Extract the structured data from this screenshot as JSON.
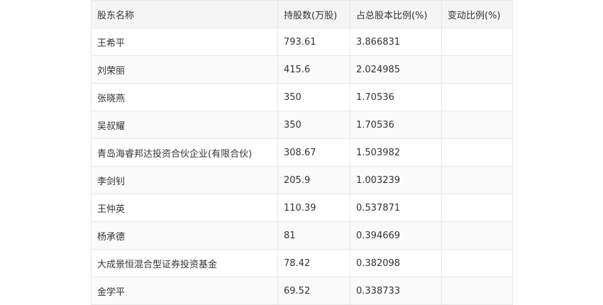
{
  "table": {
    "headers": [
      "股东名称",
      "持股数(万股)",
      "占总股本比例(%)",
      "变动比例(%)"
    ],
    "rows": [
      {
        "name": "王希平",
        "shares": "793.61",
        "ratio": "3.866831",
        "change": ""
      },
      {
        "name": "刘荣丽",
        "shares": "415.6",
        "ratio": "2.024985",
        "change": ""
      },
      {
        "name": "张晓燕",
        "shares": "350",
        "ratio": "1.70536",
        "change": ""
      },
      {
        "name": "吴叔耀",
        "shares": "350",
        "ratio": "1.70536",
        "change": ""
      },
      {
        "name": "青岛海睿邦达投资合伙企业(有限合伙)",
        "shares": "308.67",
        "ratio": "1.503982",
        "change": ""
      },
      {
        "name": "李剑钊",
        "shares": "205.9",
        "ratio": "1.003239",
        "change": ""
      },
      {
        "name": "王仲英",
        "shares": "110.39",
        "ratio": "0.537871",
        "change": ""
      },
      {
        "name": "杨承德",
        "shares": "81",
        "ratio": "0.394669",
        "change": ""
      },
      {
        "name": "大成景恒混合型证券投资基金",
        "shares": "78.42",
        "ratio": "0.382098",
        "change": ""
      },
      {
        "name": "金学平",
        "shares": "69.52",
        "ratio": "0.338733",
        "change": ""
      }
    ]
  }
}
